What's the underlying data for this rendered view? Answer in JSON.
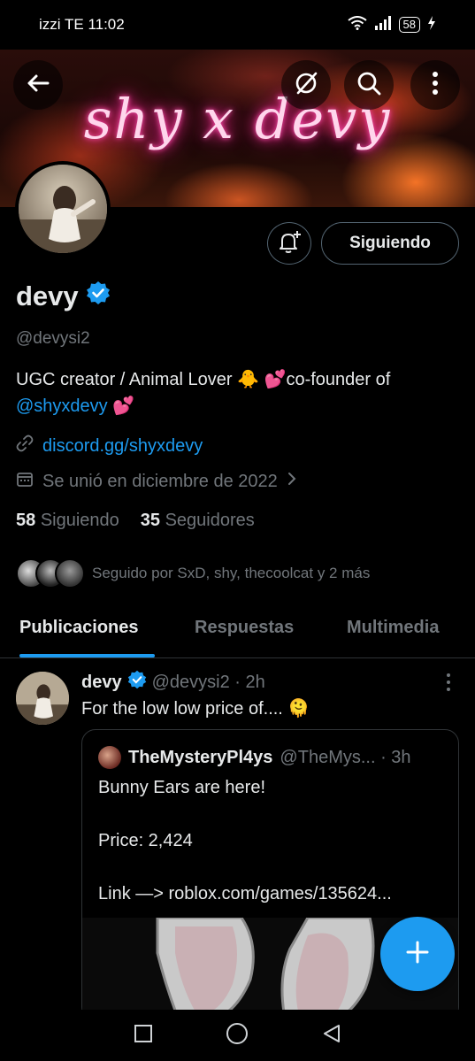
{
  "status_bar": {
    "carrier": "izzi TE",
    "time": "11:02",
    "battery": "58"
  },
  "banner": {
    "text": "shy x devy"
  },
  "profile": {
    "name": "devy",
    "handle": "@devysi2",
    "bio_line1": "UGC creator / Animal Lover 🐥   💕co-founder of",
    "bio_mention": "@shyxdevy",
    "bio_emoji": "💕",
    "link": "discord.gg/shyxdevy",
    "joined": "Se unió en diciembre de 2022",
    "following_count": "58",
    "following_label": "Siguiendo",
    "followers_count": "35",
    "followers_label": "Seguidores",
    "followed_by": "Seguido por SxD, shy, thecoolcat y 2 más",
    "follow_button": "Siguiendo"
  },
  "tabs": [
    "Publicaciones",
    "Respuestas",
    "Multimedia"
  ],
  "tweet": {
    "name": "devy",
    "handle_time": "@devysi2 · 2h",
    "text": "For the low low price of.... 🫠",
    "quote": {
      "name": "TheMysteryPl4ys",
      "handle_time": "@TheMys... · 3h",
      "line1": "Bunny Ears are here!",
      "line2": "Price: 2,424",
      "line3": "Link —> roblox.com/games/135624..."
    }
  },
  "colors": {
    "accent": "#1d9bf0",
    "muted": "#71767b",
    "border": "#2f3336"
  }
}
